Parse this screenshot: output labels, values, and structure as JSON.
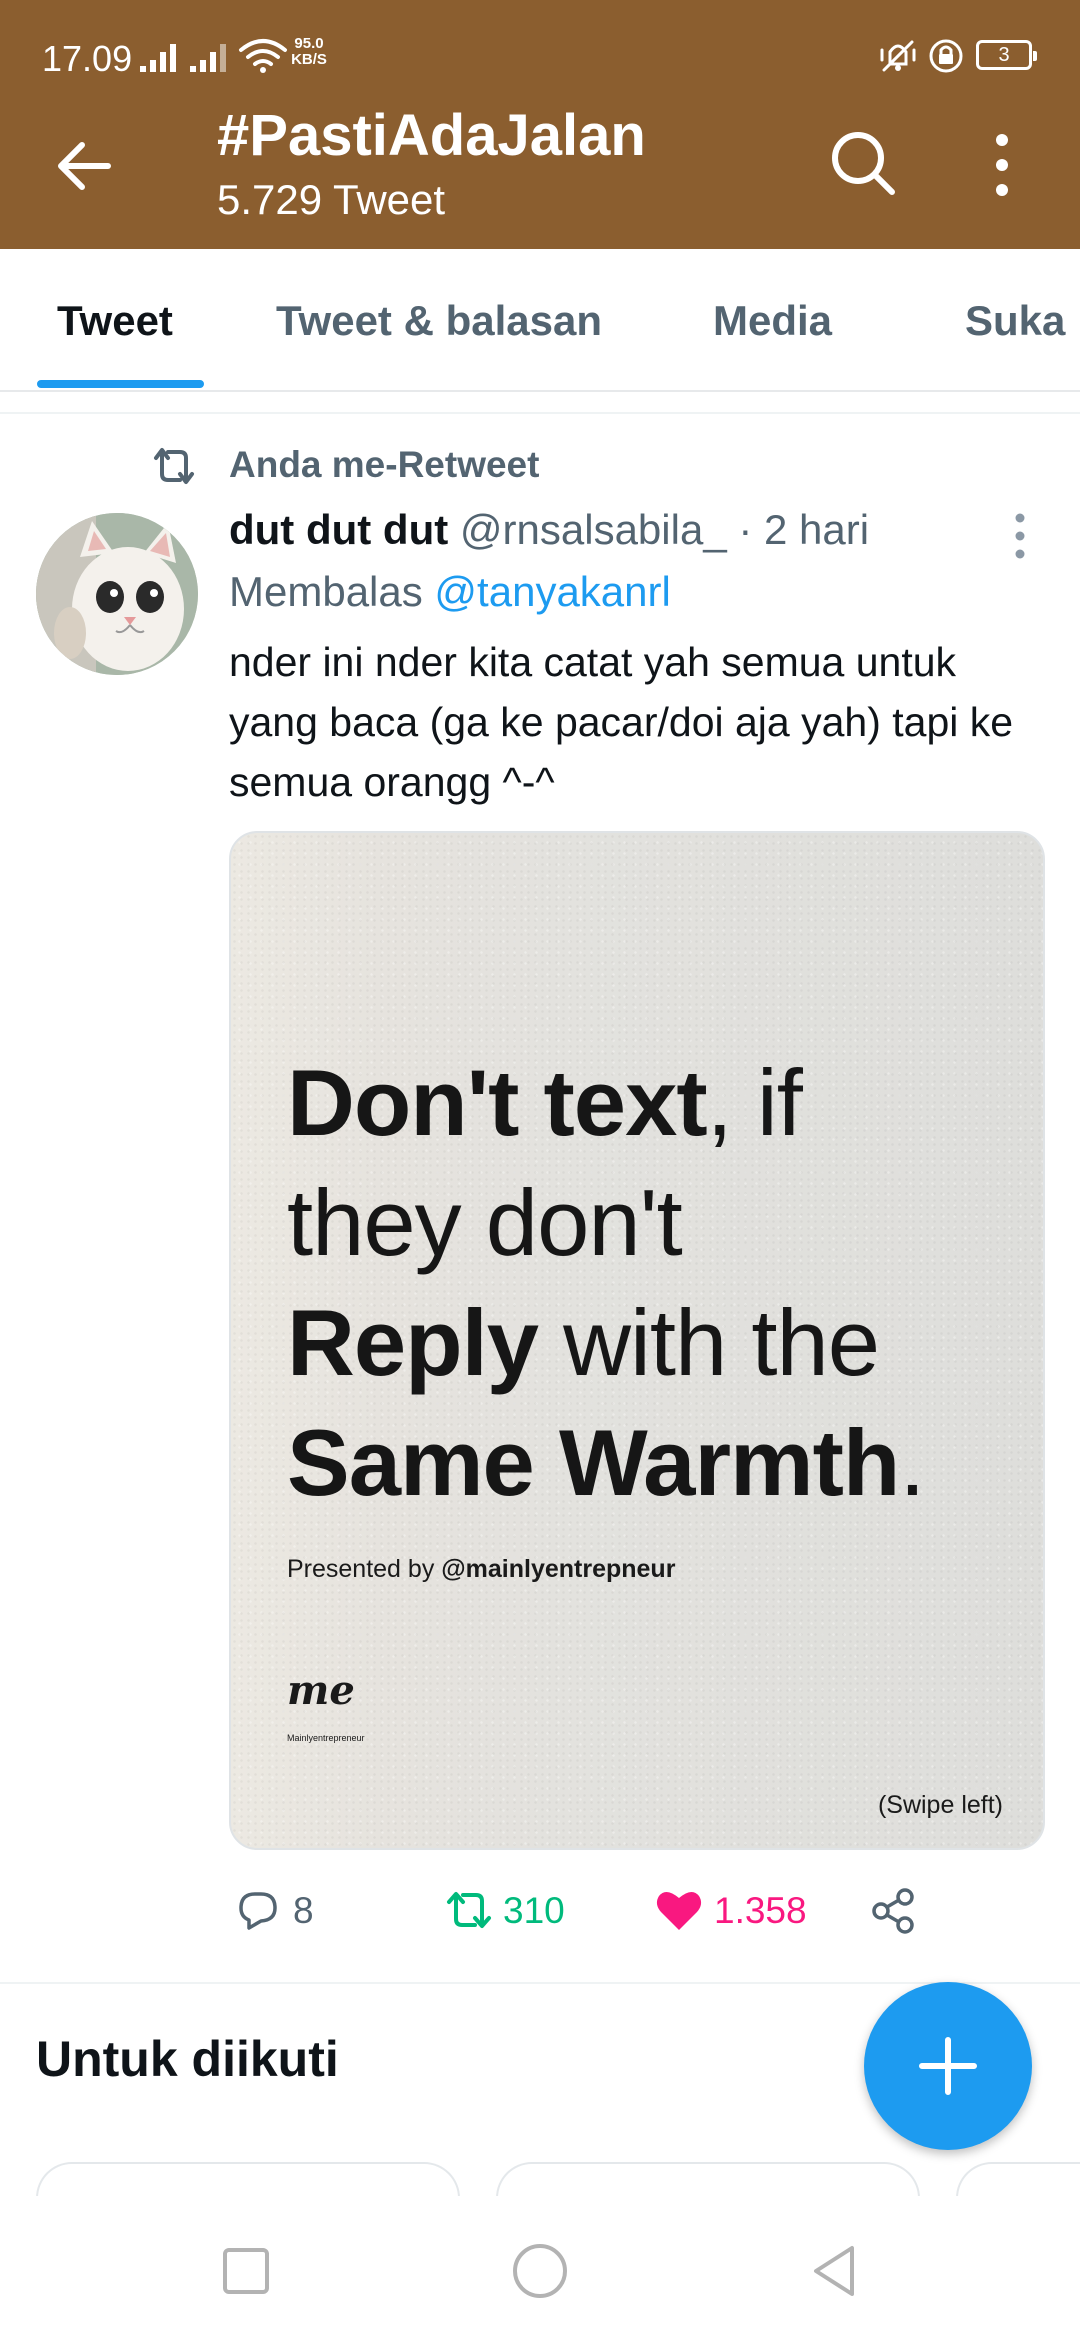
{
  "status_bar": {
    "time": "17.09",
    "net_speed_value": "95.0",
    "net_speed_unit": "KB/S",
    "battery": "3"
  },
  "header": {
    "title": "#PastiAdaJalan",
    "subtitle": "5.729 Tweet",
    "back_icon": "arrow-left-icon",
    "search_icon": "search-icon",
    "more_icon": "more-vertical-icon",
    "background_color": "#8b5e2f"
  },
  "tabs": [
    {
      "label": "Tweet",
      "active": true
    },
    {
      "label": "Tweet & balasan",
      "active": false
    },
    {
      "label": "Media",
      "active": false
    },
    {
      "label": "Suka",
      "active": false
    }
  ],
  "tweet": {
    "retweet_notice": "Anda me-Retweet",
    "name": "dut dut dut",
    "handle": "@rnsalsabila_",
    "separator": "·",
    "time": "2 hari",
    "reply_prefix": "Membalas",
    "reply_handle": "@tanyakanrl",
    "text": "nder ini nder kita catat yah semua untuk yang baca (ga ke pacar/doi aja yah) tapi ke semua orangg ^-^",
    "media": {
      "line1_bold": "Don't text",
      "line1_rest": ", if",
      "line2": "they don't",
      "line3_bold": "Reply",
      "line3_rest": " with the",
      "line4_bold": "Same Warmth",
      "line4_rest": ".",
      "presented_prefix": "Presented by ",
      "presented_handle": "@mainlyentrepneur",
      "logo": "me",
      "logo_sub": "Mainlyentrepreneur",
      "swipe": "(Swipe left)"
    },
    "actions": {
      "replies": "8",
      "retweets": "310",
      "likes": "1.358"
    },
    "colors": {
      "accent": "#1d9bf0",
      "retweet": "#00ba7c",
      "like": "#f91880",
      "muted": "#536471"
    }
  },
  "section": {
    "title": "Untuk diikuti"
  },
  "fab": {
    "icon": "plus-icon"
  }
}
